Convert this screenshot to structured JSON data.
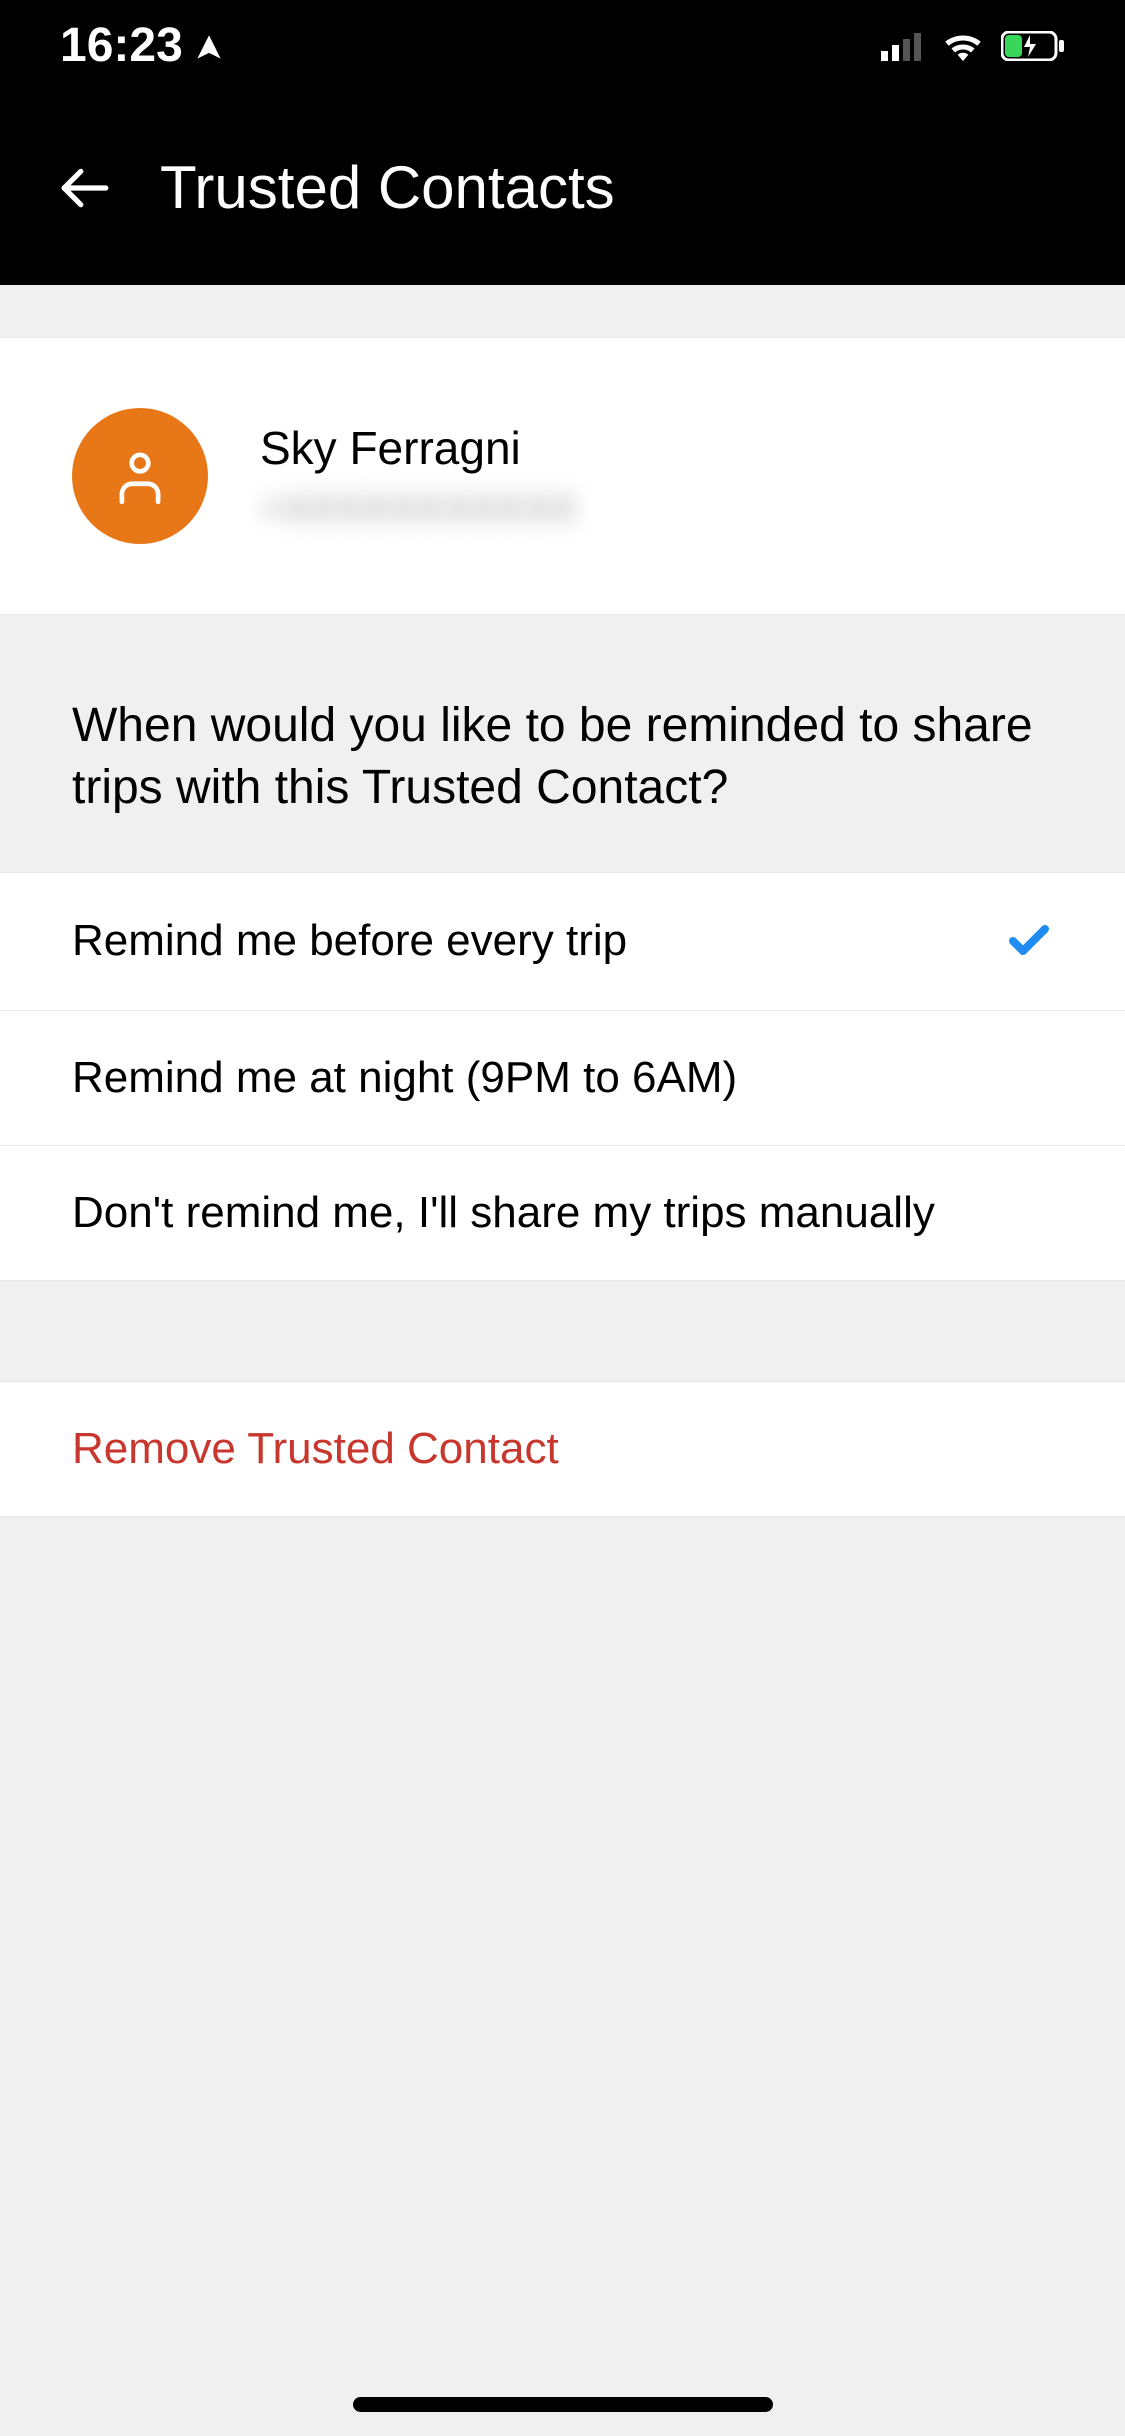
{
  "status_bar": {
    "time": "16:23"
  },
  "header": {
    "title": "Trusted Contacts"
  },
  "contact": {
    "name": "Sky Ferragni",
    "phone": "+XXXXXXXXXXX"
  },
  "reminder": {
    "question": "When would you like to be reminded to share trips with this Trusted Contact?",
    "options": [
      {
        "label": "Remind me before every trip",
        "selected": true
      },
      {
        "label": "Remind me at night (9PM to 6AM)",
        "selected": false
      },
      {
        "label": "Don't remind me, I'll share my trips manually",
        "selected": false
      }
    ]
  },
  "actions": {
    "remove": "Remove Trusted Contact"
  }
}
